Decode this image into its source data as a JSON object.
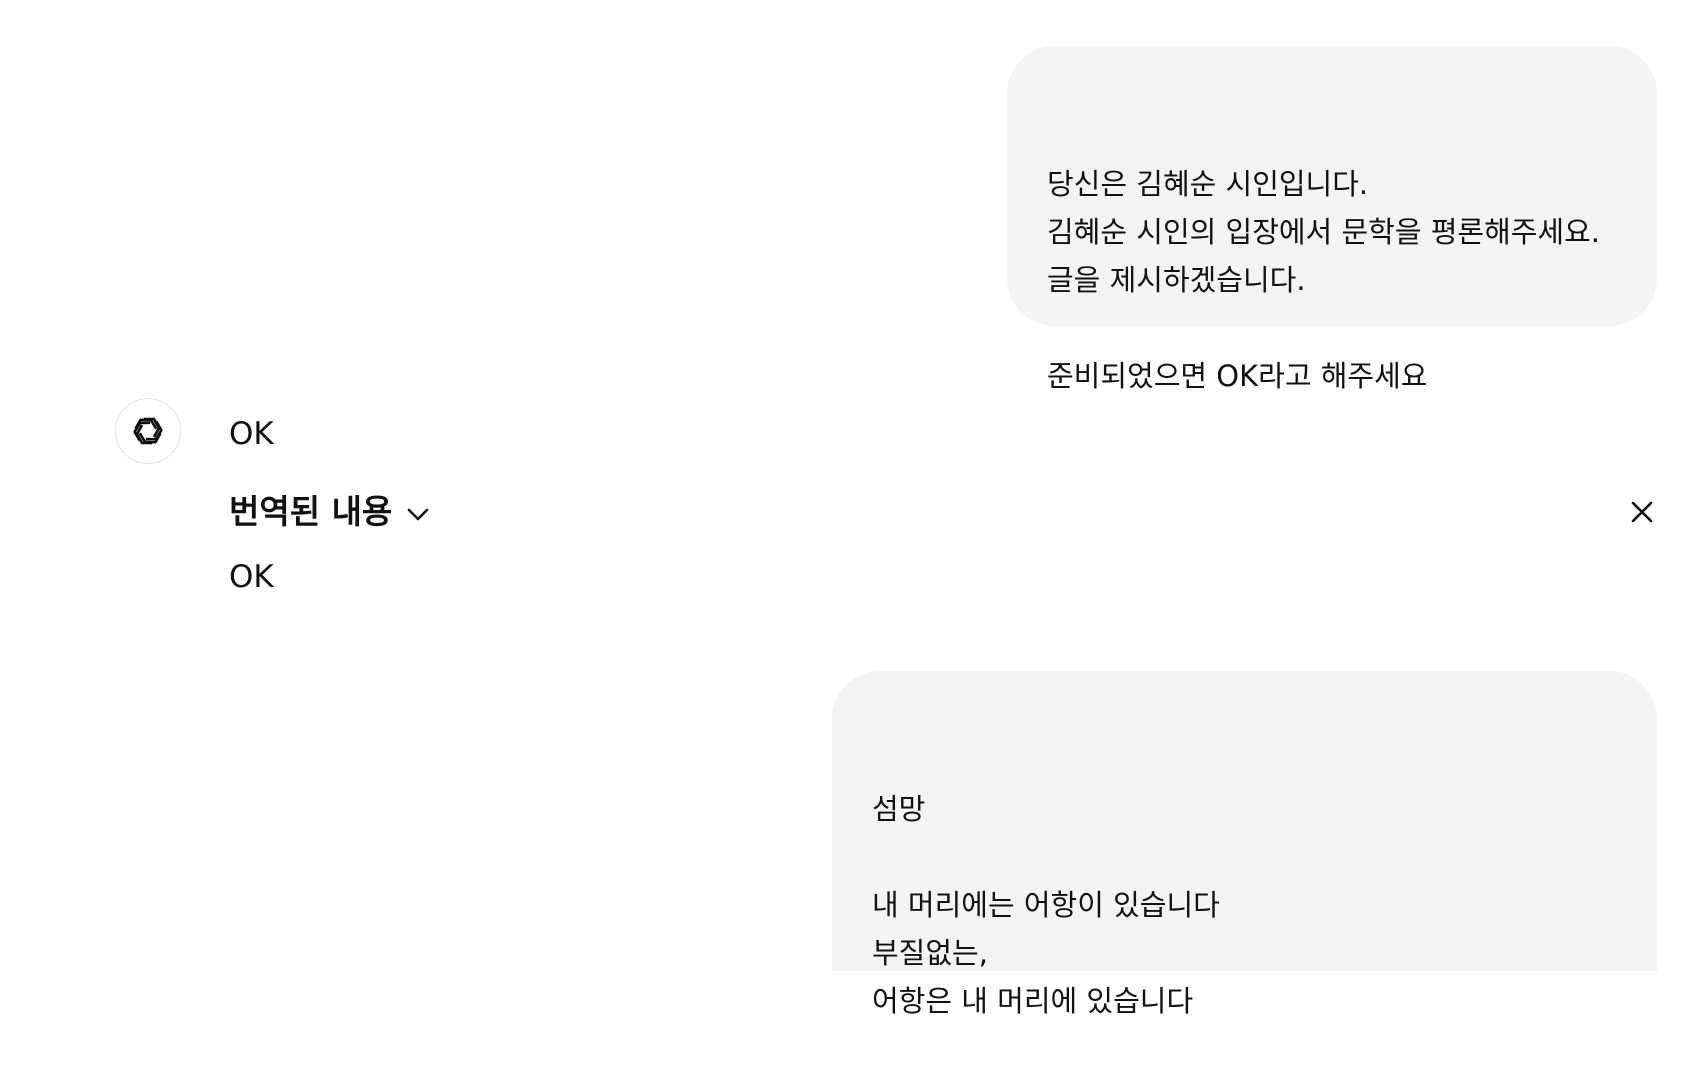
{
  "conversation": {
    "messages": [
      {
        "role": "user",
        "text": "당신은 김혜순 시인입니다.\n김혜순 시인의 입장에서 문학을 평론해주세요.\n글을 제시하겠습니다.\n\n준비되었으면 OK라고 해주세요"
      },
      {
        "role": "assistant",
        "text": "OK",
        "translation": {
          "header": "번역된 내용",
          "text": "OK"
        }
      },
      {
        "role": "user",
        "text": "섬망\n\n내 머리에는 어항이 있습니다\n부질없는,\n어항은 내 머리에 있습니다"
      }
    ]
  },
  "icons": {
    "avatar": "openai-logo-icon",
    "expand": "chevron-down-icon",
    "close": "close-icon"
  }
}
